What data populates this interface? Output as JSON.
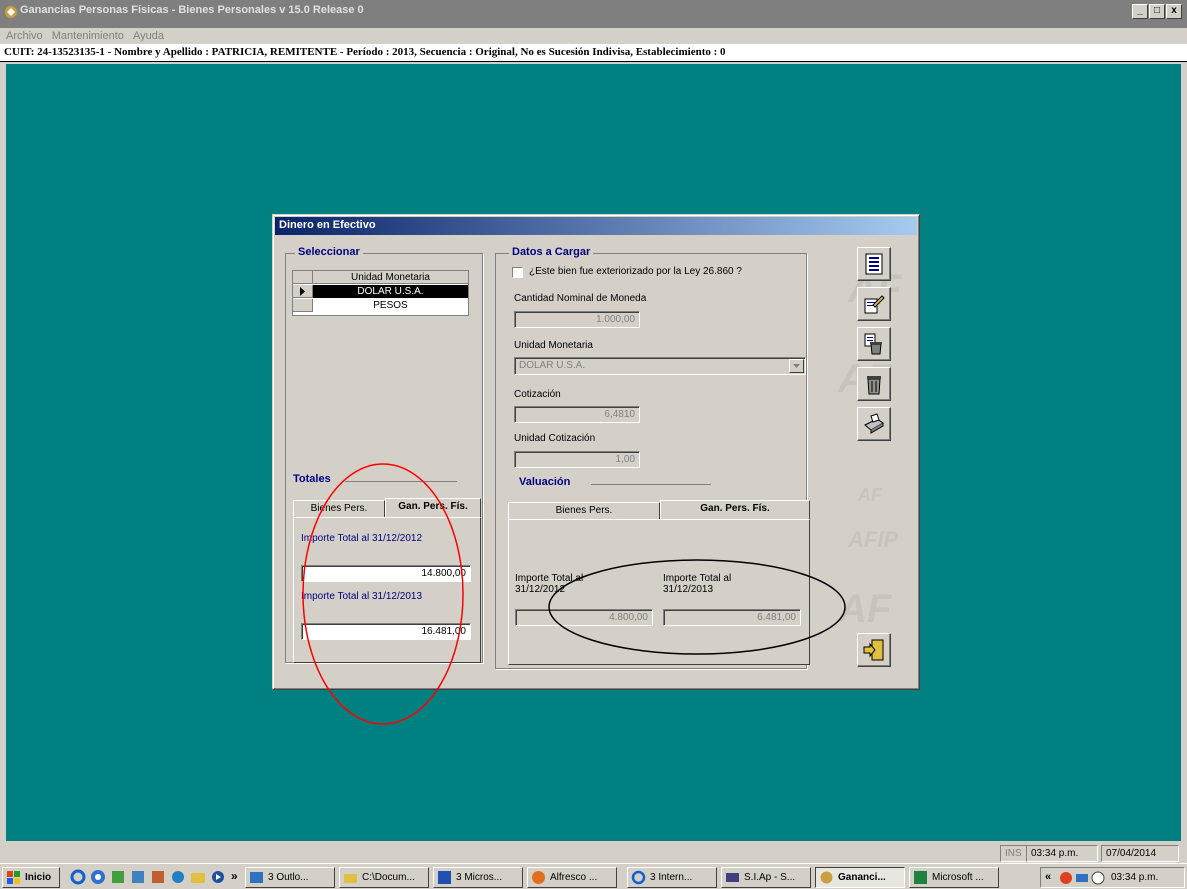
{
  "window": {
    "title": "Ganancias Personas Físicas - Bienes Personales v 15.0 Release 0",
    "minimize": "_",
    "maximize": "□",
    "close": "x"
  },
  "menu": [
    "Archivo",
    "Mantenimiento",
    "Ayuda"
  ],
  "infobar": "CUIT: 24-13523135-1 -  Nombre y Apellido : PATRICIA, REMITENTE -  Período : 2013,  Secuencia : Original, No es Sucesión Indivisa, Establecimiento : 0",
  "dialog": {
    "title": "Dinero en Efectivo",
    "seleccionar": {
      "legend": "Seleccionar",
      "column": "Unidad Monetaria",
      "rows": [
        "DOLAR U.S.A.",
        "PESOS"
      ],
      "selected_row": "DOLAR U.S.A."
    },
    "totales": {
      "legend": "Totales",
      "tabs": [
        "Bienes Pers.",
        "Gan. Pers. Fís."
      ],
      "active_tab": "Gan. Pers. Fís.",
      "label_2012": "Importe Total al 31/12/2012",
      "value_2012": "14.800,00",
      "label_2013": "Importe Total al 31/12/2013",
      "value_2013": "16.481,00"
    },
    "datos": {
      "legend": "Datos a Cargar",
      "checkbox_label": "¿Este bien fue exteriorizado por la Ley 26.860 ?",
      "cantidad_label": "Cantidad Nominal de Moneda",
      "cantidad_value": "1.000,00",
      "unidad_label": "Unidad Monetaria",
      "unidad_value": "DOLAR U.S.A.",
      "cotizacion_label": "Cotización",
      "cotizacion_value": "6,4810",
      "unidad_cot_label": "Unidad Cotización",
      "unidad_cot_value": "1,00"
    },
    "valuacion": {
      "legend": "Valuación",
      "tabs": [
        "Bienes Pers.",
        "Gan. Pers. Fís."
      ],
      "active_tab": "Gan. Pers. Fís.",
      "label_2012_a": "Importe Total al",
      "label_2012_b": "31/12/2012",
      "value_2012": "4.800,00",
      "label_2013_a": "Importe Total al",
      "label_2013_b": "31/12/2013",
      "value_2013": "6.481,00"
    },
    "toolbar_icons": [
      "list-icon",
      "edit-icon",
      "delete-document-icon",
      "trash-icon",
      "print-icon",
      "exit-door-icon"
    ]
  },
  "status": {
    "ins": "INS",
    "time": "03:34 p.m.",
    "date": "07/04/2014"
  },
  "taskbar": {
    "start": "Inicio",
    "chevron": "»",
    "items": [
      "3 Outlo...",
      "C:\\Docum...",
      "3 Micros...",
      "Alfresco ...",
      "3 Intern...",
      "S.I.Ap - S...",
      "Gananci...",
      "Microsoft ..."
    ],
    "active": "Gananci...",
    "tray_chevron": "«",
    "clock": "03:34 p.m."
  },
  "annotation_colors": {
    "red_circle": "#ff0000",
    "black_ellipse": "#000000"
  }
}
